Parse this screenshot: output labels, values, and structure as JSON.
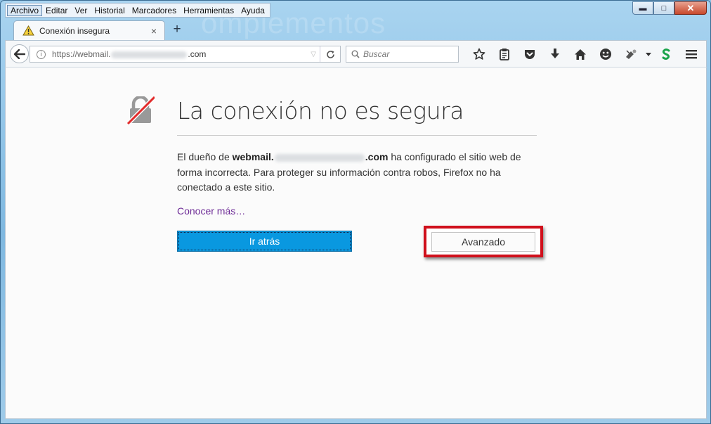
{
  "menu": [
    "Archivo",
    "Editar",
    "Ver",
    "Historial",
    "Marcadores",
    "Herramientas",
    "Ayuda"
  ],
  "watermark": "omplementos",
  "window_controls": {
    "minimize": "▬",
    "maximize": "□",
    "close": "✕"
  },
  "tab": {
    "title": "Conexión insegura",
    "close": "×",
    "new_tab": "+"
  },
  "url": {
    "prefix": "https://webmail.",
    "suffix": ".com"
  },
  "search": {
    "placeholder": "Buscar"
  },
  "page": {
    "title": "La conexión no es segura",
    "desc_part1": "El dueño de ",
    "host_bold_prefix": "webmail.",
    "host_bold_suffix": ".com",
    "desc_part2": " ha configurado el sitio web de forma incorrecta. Para proteger su información contra robos, Firefox no ha conectado a este sitio.",
    "learn_more": "Conocer más…",
    "go_back": "Ir atrás",
    "advanced": "Avanzado"
  },
  "colors": {
    "primary_button": "#0998e0",
    "highlight_box": "#d0101c",
    "link": "#6d2b96"
  }
}
